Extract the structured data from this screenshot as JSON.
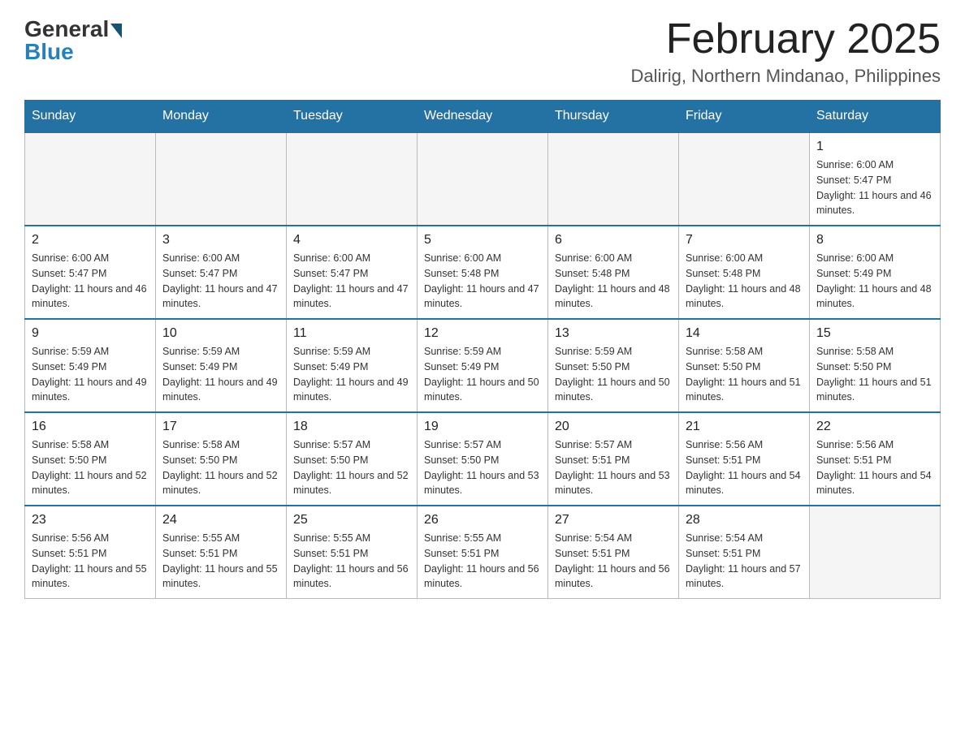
{
  "logo": {
    "general": "General",
    "blue": "Blue"
  },
  "title": "February 2025",
  "subtitle": "Dalirig, Northern Mindanao, Philippines",
  "days_of_week": [
    "Sunday",
    "Monday",
    "Tuesday",
    "Wednesday",
    "Thursday",
    "Friday",
    "Saturday"
  ],
  "weeks": [
    [
      {
        "day": "",
        "info": ""
      },
      {
        "day": "",
        "info": ""
      },
      {
        "day": "",
        "info": ""
      },
      {
        "day": "",
        "info": ""
      },
      {
        "day": "",
        "info": ""
      },
      {
        "day": "",
        "info": ""
      },
      {
        "day": "1",
        "info": "Sunrise: 6:00 AM\nSunset: 5:47 PM\nDaylight: 11 hours and 46 minutes."
      }
    ],
    [
      {
        "day": "2",
        "info": "Sunrise: 6:00 AM\nSunset: 5:47 PM\nDaylight: 11 hours and 46 minutes."
      },
      {
        "day": "3",
        "info": "Sunrise: 6:00 AM\nSunset: 5:47 PM\nDaylight: 11 hours and 47 minutes."
      },
      {
        "day": "4",
        "info": "Sunrise: 6:00 AM\nSunset: 5:47 PM\nDaylight: 11 hours and 47 minutes."
      },
      {
        "day": "5",
        "info": "Sunrise: 6:00 AM\nSunset: 5:48 PM\nDaylight: 11 hours and 47 minutes."
      },
      {
        "day": "6",
        "info": "Sunrise: 6:00 AM\nSunset: 5:48 PM\nDaylight: 11 hours and 48 minutes."
      },
      {
        "day": "7",
        "info": "Sunrise: 6:00 AM\nSunset: 5:48 PM\nDaylight: 11 hours and 48 minutes."
      },
      {
        "day": "8",
        "info": "Sunrise: 6:00 AM\nSunset: 5:49 PM\nDaylight: 11 hours and 48 minutes."
      }
    ],
    [
      {
        "day": "9",
        "info": "Sunrise: 5:59 AM\nSunset: 5:49 PM\nDaylight: 11 hours and 49 minutes."
      },
      {
        "day": "10",
        "info": "Sunrise: 5:59 AM\nSunset: 5:49 PM\nDaylight: 11 hours and 49 minutes."
      },
      {
        "day": "11",
        "info": "Sunrise: 5:59 AM\nSunset: 5:49 PM\nDaylight: 11 hours and 49 minutes."
      },
      {
        "day": "12",
        "info": "Sunrise: 5:59 AM\nSunset: 5:49 PM\nDaylight: 11 hours and 50 minutes."
      },
      {
        "day": "13",
        "info": "Sunrise: 5:59 AM\nSunset: 5:50 PM\nDaylight: 11 hours and 50 minutes."
      },
      {
        "day": "14",
        "info": "Sunrise: 5:58 AM\nSunset: 5:50 PM\nDaylight: 11 hours and 51 minutes."
      },
      {
        "day": "15",
        "info": "Sunrise: 5:58 AM\nSunset: 5:50 PM\nDaylight: 11 hours and 51 minutes."
      }
    ],
    [
      {
        "day": "16",
        "info": "Sunrise: 5:58 AM\nSunset: 5:50 PM\nDaylight: 11 hours and 52 minutes."
      },
      {
        "day": "17",
        "info": "Sunrise: 5:58 AM\nSunset: 5:50 PM\nDaylight: 11 hours and 52 minutes."
      },
      {
        "day": "18",
        "info": "Sunrise: 5:57 AM\nSunset: 5:50 PM\nDaylight: 11 hours and 52 minutes."
      },
      {
        "day": "19",
        "info": "Sunrise: 5:57 AM\nSunset: 5:50 PM\nDaylight: 11 hours and 53 minutes."
      },
      {
        "day": "20",
        "info": "Sunrise: 5:57 AM\nSunset: 5:51 PM\nDaylight: 11 hours and 53 minutes."
      },
      {
        "day": "21",
        "info": "Sunrise: 5:56 AM\nSunset: 5:51 PM\nDaylight: 11 hours and 54 minutes."
      },
      {
        "day": "22",
        "info": "Sunrise: 5:56 AM\nSunset: 5:51 PM\nDaylight: 11 hours and 54 minutes."
      }
    ],
    [
      {
        "day": "23",
        "info": "Sunrise: 5:56 AM\nSunset: 5:51 PM\nDaylight: 11 hours and 55 minutes."
      },
      {
        "day": "24",
        "info": "Sunrise: 5:55 AM\nSunset: 5:51 PM\nDaylight: 11 hours and 55 minutes."
      },
      {
        "day": "25",
        "info": "Sunrise: 5:55 AM\nSunset: 5:51 PM\nDaylight: 11 hours and 56 minutes."
      },
      {
        "day": "26",
        "info": "Sunrise: 5:55 AM\nSunset: 5:51 PM\nDaylight: 11 hours and 56 minutes."
      },
      {
        "day": "27",
        "info": "Sunrise: 5:54 AM\nSunset: 5:51 PM\nDaylight: 11 hours and 56 minutes."
      },
      {
        "day": "28",
        "info": "Sunrise: 5:54 AM\nSunset: 5:51 PM\nDaylight: 11 hours and 57 minutes."
      },
      {
        "day": "",
        "info": ""
      }
    ]
  ]
}
